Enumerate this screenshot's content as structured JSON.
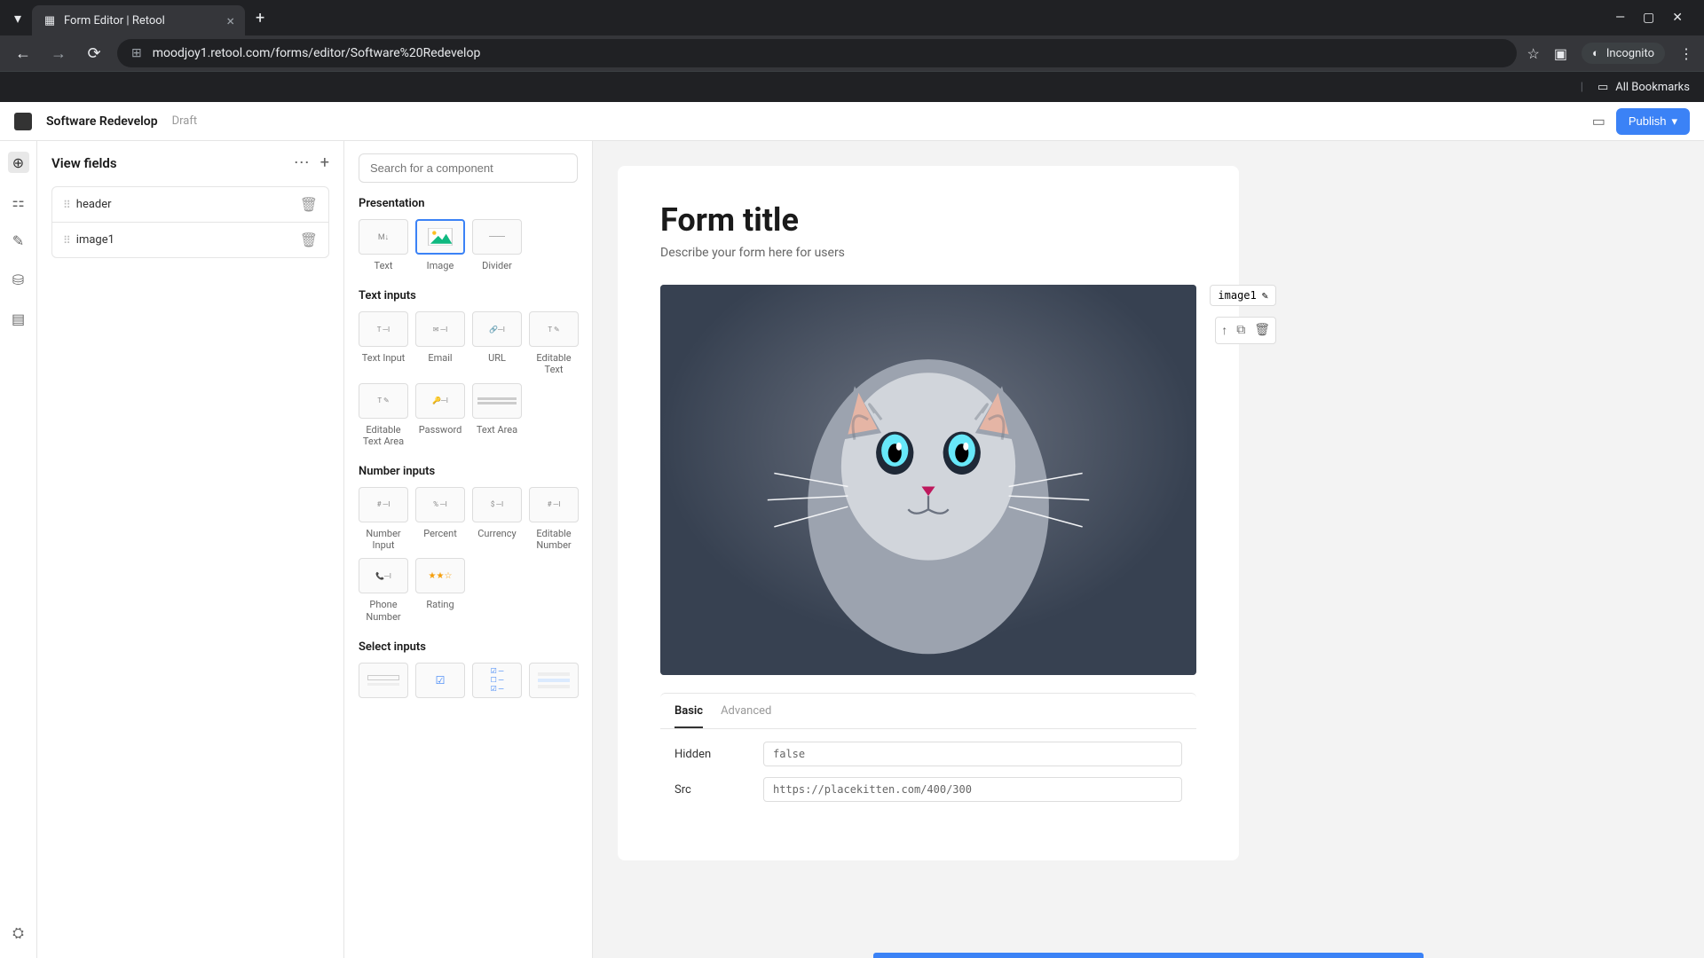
{
  "browser": {
    "tab_title": "Form Editor | Retool",
    "url": "moodjoy1.retool.com/forms/editor/Software%20Redevelop",
    "incognito_label": "Incognito",
    "all_bookmarks": "All Bookmarks"
  },
  "header": {
    "project_name": "Software Redevelop",
    "status": "Draft",
    "publish_label": "Publish"
  },
  "fields_panel": {
    "title": "View fields",
    "items": [
      {
        "name": "header"
      },
      {
        "name": "image1"
      }
    ]
  },
  "components": {
    "search_placeholder": "Search for a component",
    "sections": {
      "presentation": {
        "title": "Presentation",
        "items": [
          "Text",
          "Image",
          "Divider"
        ]
      },
      "text_inputs": {
        "title": "Text inputs",
        "items": [
          "Text Input",
          "Email",
          "URL",
          "Editable Text",
          "Editable Text Area",
          "Password",
          "Text Area"
        ]
      },
      "number_inputs": {
        "title": "Number inputs",
        "items": [
          "Number Input",
          "Percent",
          "Currency",
          "Editable Number",
          "Phone Number",
          "Rating"
        ]
      },
      "select_inputs": {
        "title": "Select inputs"
      }
    }
  },
  "form": {
    "title": "Form title",
    "description": "Describe your form here for users",
    "selected_element": "image1"
  },
  "props": {
    "tabs": {
      "basic": "Basic",
      "advanced": "Advanced"
    },
    "hidden_label": "Hidden",
    "hidden_value": "false",
    "src_label": "Src",
    "src_value": "https://placekitten.com/400/300"
  }
}
